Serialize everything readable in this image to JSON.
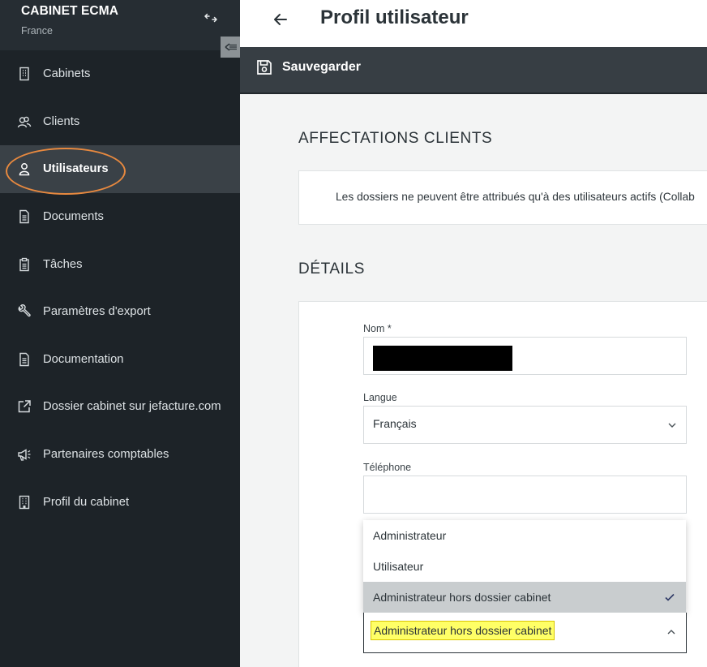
{
  "sidebar": {
    "firm_name": "CABINET ECMA",
    "country": "France",
    "items": [
      {
        "label": "Cabinets",
        "icon": "building-icon"
      },
      {
        "label": "Clients",
        "icon": "users-icon"
      },
      {
        "label": "Utilisateurs",
        "icon": "user-icon"
      },
      {
        "label": "Documents",
        "icon": "document-icon"
      },
      {
        "label": "Tâches",
        "icon": "clipboard-icon"
      },
      {
        "label": "Paramètres d'export",
        "icon": "wrench-icon"
      },
      {
        "label": "Documentation",
        "icon": "document-icon"
      },
      {
        "label": "Dossier cabinet sur jefacture.com",
        "icon": "external-link-icon"
      },
      {
        "label": "Partenaires comptables",
        "icon": "megaphone-icon"
      },
      {
        "label": "Profil du cabinet",
        "icon": "building-icon"
      }
    ],
    "active_item": "Utilisateurs"
  },
  "header": {
    "title": "Profil utilisateur"
  },
  "toolbar": {
    "save_label": "Sauvegarder"
  },
  "assignments": {
    "section_title": "AFFECTATIONS CLIENTS",
    "info": "Les dossiers ne peuvent être attribués qu'à des utilisateurs actifs (Collab"
  },
  "details": {
    "section_title": "DÉTAILS",
    "name_label": "Nom *",
    "language_label": "Langue",
    "language_value": "Français",
    "phone_label": "Téléphone",
    "phone_value": "",
    "role_options": [
      "Administrateur",
      "Utilisateur",
      "Administrateur hors dossier cabinet"
    ],
    "role_value": "Administrateur hors dossier cabinet"
  },
  "colors": {
    "sidebar_bg": "#1d2328",
    "active_bg": "#3a4147",
    "annotation": "#e8893f",
    "highlight": "#ffff66"
  }
}
